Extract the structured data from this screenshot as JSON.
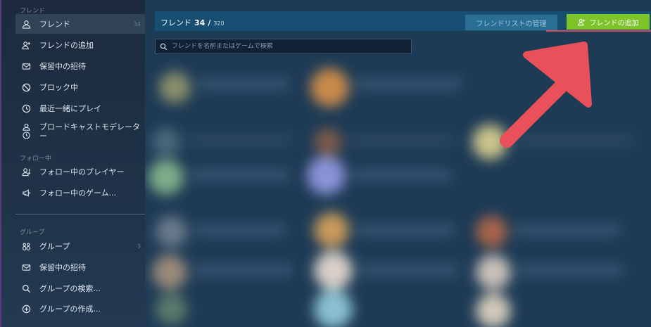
{
  "sidebar": {
    "friends_section": "フレンド",
    "following_section": "フォロー中",
    "groups_section": "グループ",
    "items": [
      {
        "label": "フレンド",
        "count": "34",
        "icon": "user-icon"
      },
      {
        "label": "フレンドの追加",
        "icon": "add-user-icon"
      },
      {
        "label": "保留中の招待",
        "icon": "envelope-icon"
      },
      {
        "label": "ブロック中",
        "icon": "block-icon"
      },
      {
        "label": "最近一緒にプレイ",
        "icon": "clock-icon"
      },
      {
        "label": "ブロードキャストモデレーター",
        "icon": "user-clock-icon"
      },
      {
        "label": "フォロー中のプレイヤー",
        "icon": "follow-user-icon"
      },
      {
        "label": "フォロー中のゲーム...",
        "icon": "megaphone-icon"
      },
      {
        "label": "グループ",
        "count": "3",
        "icon": "group-icon"
      },
      {
        "label": "保留中の招待",
        "icon": "envelope-icon"
      },
      {
        "label": "グループの検索...",
        "icon": "search-icon"
      },
      {
        "label": "グループの作成...",
        "icon": "plus-circle-icon"
      }
    ]
  },
  "header": {
    "title": "フレンド",
    "count": "34",
    "separator": "/",
    "total": "320",
    "manage_button": "フレンドリストの管理",
    "add_button": "フレンドの追加"
  },
  "search": {
    "placeholder": "フレンドを名前またはゲームで検索"
  },
  "colors": {
    "accent_green": "#7cc42a",
    "header_blue": "#164f72",
    "arrow_red": "#e8505a"
  }
}
